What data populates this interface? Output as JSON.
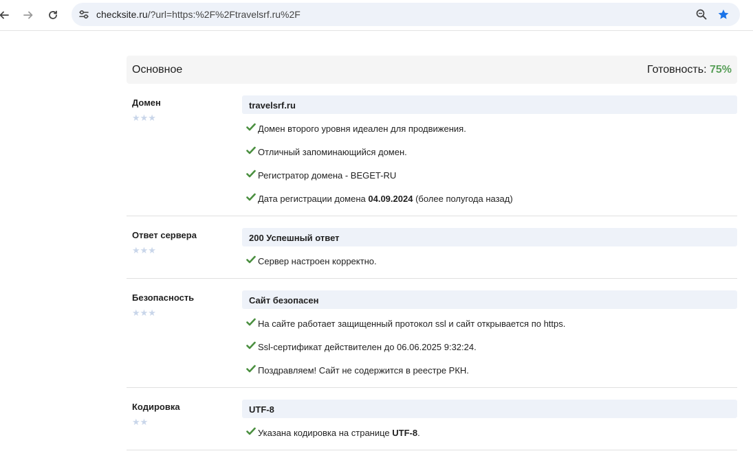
{
  "browser": {
    "url_host": "checksite.ru",
    "url_rest": "/?url=https:%2F%2Ftravelsrf.ru%2F"
  },
  "report": {
    "title": "Основное",
    "readiness_label": "Готовность: ",
    "readiness_value": "75%"
  },
  "sections": [
    {
      "label": "Домен",
      "stars": "★★★",
      "value": "travelsrf.ru",
      "items": [
        {
          "text": "Домен второго уровня идеален для продвижения."
        },
        {
          "text": "Отличный запоминающийся домен."
        },
        {
          "text": "Регистратор домена - BEGET-RU"
        },
        {
          "pre": "Дата регистрации домена ",
          "bold": "04.09.2024",
          "post": " (более полугода назад)"
        }
      ]
    },
    {
      "label": "Ответ сервера",
      "stars": "★★★",
      "value": "200 Успешный ответ",
      "items": [
        {
          "text": "Сервер настроен корректно."
        }
      ]
    },
    {
      "label": "Безопасность",
      "stars": "★★★",
      "value": "Сайт безопасен",
      "items": [
        {
          "text": "На сайте работает защищенный протокол ssl и сайт открывается по https."
        },
        {
          "text": "Ssl-сертификат действителен до 06.06.2025 9:32:24."
        },
        {
          "text": "Поздравляем! Сайт не содержится в реестре РКН."
        }
      ]
    },
    {
      "label": "Кодировка",
      "stars": "★★",
      "value": "UTF-8",
      "items": [
        {
          "pre": "Указана кодировка на странице ",
          "bold": "UTF-8",
          "post": "."
        }
      ]
    }
  ],
  "colors": {
    "accent_green": "#5aa05a",
    "check_green": "#4a8f3f",
    "star_inactive": "#c9d6ea",
    "value_bar_bg": "#eef2f9",
    "bookmark_blue": "#1a73e8"
  }
}
